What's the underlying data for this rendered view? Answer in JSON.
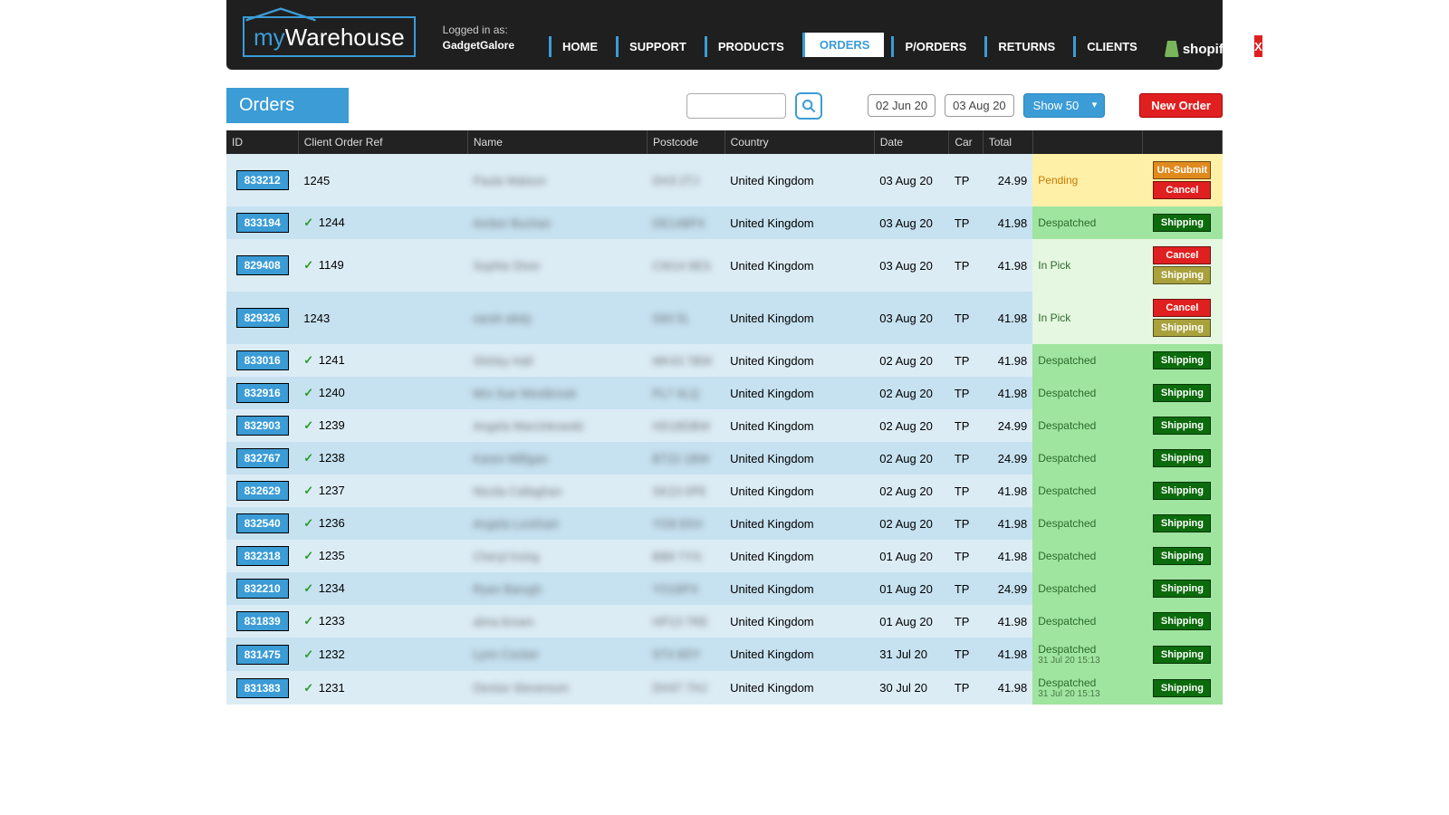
{
  "brand": {
    "part1": "my",
    "part2": "Warehouse"
  },
  "login": {
    "label": "Logged in as:",
    "user": "GadgetGalore"
  },
  "nav": {
    "items": [
      "HOME",
      "SUPPORT",
      "PRODUCTS",
      "ORDERS",
      "P/ORDERS",
      "RETURNS",
      "CLIENTS"
    ],
    "active_index": 3,
    "shopify": "shopify",
    "close": "X"
  },
  "toolbar": {
    "title": "Orders",
    "date_from": "02 Jun 20",
    "date_to": "03 Aug 20",
    "show_label": "Show 50",
    "new_order": "New Order"
  },
  "columns": [
    "ID",
    "Client Order Ref",
    "Name",
    "Postcode",
    "Country",
    "Date",
    "Car",
    "Total",
    "",
    ""
  ],
  "buttons": {
    "unsubmit": "Un-Submit",
    "cancel": "Cancel",
    "shipping": "Shipping"
  },
  "rows": [
    {
      "id": "833212",
      "tick": false,
      "ref": "1245",
      "name": "Paula Watson",
      "pc": "DH3 2TJ",
      "country": "United Kingdom",
      "date": "03 Aug 20",
      "car": "TP",
      "total": "24.99",
      "status": "Pending",
      "status_kind": "pending",
      "actions": [
        "unsubmit",
        "cancel"
      ]
    },
    {
      "id": "833194",
      "tick": true,
      "ref": "1244",
      "name": "Amber Buchan",
      "pc": "DE14BPX",
      "country": "United Kingdom",
      "date": "03 Aug 20",
      "car": "TP",
      "total": "41.98",
      "status": "Despatched",
      "status_kind": "desp",
      "actions": [
        "shipping-green"
      ]
    },
    {
      "id": "829408",
      "tick": true,
      "ref": "1149",
      "name": "Sophie Diver",
      "pc": "CW14 8ES",
      "country": "United Kingdom",
      "date": "03 Aug 20",
      "car": "TP",
      "total": "41.98",
      "status": "In Pick",
      "status_kind": "pick",
      "actions": [
        "cancel",
        "shipping-olive"
      ]
    },
    {
      "id": "829326",
      "tick": false,
      "ref": "1243",
      "name": "sarah abdy",
      "pc": "S60 5L",
      "country": "United Kingdom",
      "date": "03 Aug 20",
      "car": "TP",
      "total": "41.98",
      "status": "In Pick",
      "status_kind": "pick",
      "actions": [
        "cancel",
        "shipping-olive"
      ]
    },
    {
      "id": "833016",
      "tick": true,
      "ref": "1241",
      "name": "Shirley Hall",
      "pc": "MK43 7BW",
      "country": "United Kingdom",
      "date": "02 Aug 20",
      "car": "TP",
      "total": "41.98",
      "status": "Despatched",
      "status_kind": "desp",
      "actions": [
        "shipping-green"
      ]
    },
    {
      "id": "832916",
      "tick": true,
      "ref": "1240",
      "name": "Mrs Sue Westbrook",
      "pc": "PL7 4LQ",
      "country": "United Kingdom",
      "date": "02 Aug 20",
      "car": "TP",
      "total": "41.98",
      "status": "Despatched",
      "status_kind": "desp",
      "actions": [
        "shipping-green"
      ]
    },
    {
      "id": "832903",
      "tick": true,
      "ref": "1239",
      "name": "Angela Marcinkowski",
      "pc": "HD18DBW",
      "country": "United Kingdom",
      "date": "02 Aug 20",
      "car": "TP",
      "total": "24.99",
      "status": "Despatched",
      "status_kind": "desp",
      "actions": [
        "shipping-green"
      ]
    },
    {
      "id": "832767",
      "tick": true,
      "ref": "1238",
      "name": "Karen Milligan",
      "pc": "BT22 1BW",
      "country": "United Kingdom",
      "date": "02 Aug 20",
      "car": "TP",
      "total": "24.99",
      "status": "Despatched",
      "status_kind": "desp",
      "actions": [
        "shipping-green"
      ]
    },
    {
      "id": "832629",
      "tick": true,
      "ref": "1237",
      "name": "Nicola Callaghan",
      "pc": "SK23 0PE",
      "country": "United Kingdom",
      "date": "02 Aug 20",
      "car": "TP",
      "total": "41.98",
      "status": "Despatched",
      "status_kind": "desp",
      "actions": [
        "shipping-green"
      ]
    },
    {
      "id": "832540",
      "tick": true,
      "ref": "1236",
      "name": "Angela Lockhart",
      "pc": "YO8 8XH",
      "country": "United Kingdom",
      "date": "02 Aug 20",
      "car": "TP",
      "total": "41.98",
      "status": "Despatched",
      "status_kind": "desp",
      "actions": [
        "shipping-green"
      ]
    },
    {
      "id": "832318",
      "tick": true,
      "ref": "1235",
      "name": "Cheryl Irving",
      "pc": "BB8 7YG",
      "country": "United Kingdom",
      "date": "01 Aug 20",
      "car": "TP",
      "total": "41.98",
      "status": "Despatched",
      "status_kind": "desp",
      "actions": [
        "shipping-green"
      ]
    },
    {
      "id": "832210",
      "tick": true,
      "ref": "1234",
      "name": "Ryan Barugh",
      "pc": "YO18PX",
      "country": "United Kingdom",
      "date": "01 Aug 20",
      "car": "TP",
      "total": "24.99",
      "status": "Despatched",
      "status_kind": "desp",
      "actions": [
        "shipping-green"
      ]
    },
    {
      "id": "831839",
      "tick": true,
      "ref": "1233",
      "name": "alma brown",
      "pc": "HP13 7RE",
      "country": "United Kingdom",
      "date": "01 Aug 20",
      "car": "TP",
      "total": "41.98",
      "status": "Despatched",
      "status_kind": "desp",
      "actions": [
        "shipping-green"
      ]
    },
    {
      "id": "831475",
      "tick": true,
      "ref": "1232",
      "name": "Lynn Cocker",
      "pc": "ST4 8DY",
      "country": "United Kingdom",
      "date": "31 Jul 20",
      "car": "TP",
      "total": "41.98",
      "status": "Despatched",
      "status_sub": "31 Jul 20 15:13",
      "status_kind": "desp",
      "actions": [
        "shipping-green"
      ]
    },
    {
      "id": "831383",
      "tick": true,
      "ref": "1231",
      "name": "Denise Stevenson",
      "pc": "DH47 7HJ",
      "country": "United Kingdom",
      "date": "30 Jul 20",
      "car": "TP",
      "total": "41.98",
      "status": "Despatched",
      "status_sub": "31 Jul 20 15:13",
      "status_kind": "desp",
      "actions": [
        "shipping-green"
      ]
    }
  ]
}
